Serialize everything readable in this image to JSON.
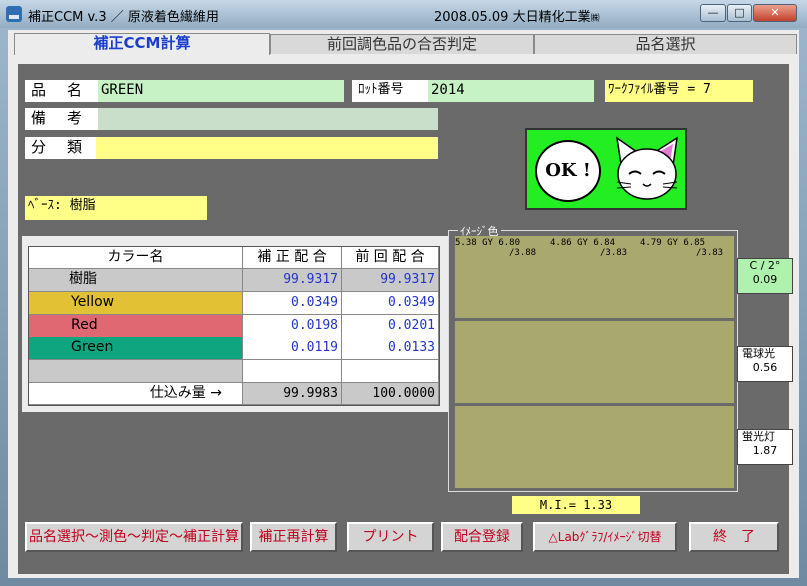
{
  "window": {
    "title": "補正CCM  v.3 ／ 原液着色繊維用",
    "title_right": "2008.05.09 大日精化工業",
    "company_mark": "㈱",
    "min": "—",
    "max": "□",
    "close": "✕"
  },
  "tabs": [
    "補正CCM計算",
    "前回調色品の合否判定",
    "品名選択"
  ],
  "form": {
    "hinmei_label": "品　名",
    "hinmei_value": "GREEN",
    "lot_label": "ﾛｯﾄ番号",
    "lot_value": "2014",
    "work_file": "ﾜｰｸﾌｧｲﾙ番号 = 7",
    "biko_label": "備　考",
    "biko_value": "",
    "bunrui_label": "分　類",
    "bunrui_value": "",
    "base": "ﾍﾞｰｽ: 樹脂"
  },
  "ok_badge": "OK !",
  "table": {
    "headers": [
      "カラー名",
      "補 正 配 合",
      "前 回 配 合"
    ],
    "rows": [
      {
        "name": "樹脂",
        "corr": "99.9317",
        "prev": "99.9317",
        "bg": "#c9c9c9",
        "fg": "#000"
      },
      {
        "name": "Yellow",
        "corr": "0.0349",
        "prev": "0.0349",
        "bg": "#e3c134",
        "fg": "#000"
      },
      {
        "name": "Red",
        "corr": "0.0198",
        "prev": "0.0201",
        "bg": "#e06873",
        "fg": "#000"
      },
      {
        "name": "Green",
        "corr": "0.0119",
        "prev": "0.0133",
        "bg": "#0fa57e",
        "fg": "#000"
      },
      {
        "name": "",
        "corr": "",
        "prev": "",
        "bg": "#c9c9c9",
        "fg": "#000"
      }
    ],
    "total_label": "仕込み量 →",
    "total_corr": "99.9983",
    "total_prev": "100.0000"
  },
  "image": {
    "label": "ｲﾒｰｼﾞ色",
    "readouts": [
      {
        "top": "5.38 GY 6.80",
        "bot": "/3.88"
      },
      {
        "top": "4.86 GY 6.84",
        "bot": "/3.83"
      },
      {
        "top": "4.79 GY 6.85",
        "bot": "/3.83"
      }
    ],
    "swatch_color": "#a9a86f"
  },
  "side": {
    "c2": "C / 2°",
    "c2_val": "0.09",
    "bulb": "電球光",
    "bulb_val": "0.56",
    "fluor": "蛍光灯",
    "fluor_val": "1.87"
  },
  "mi": "M.I.= 1.33",
  "buttons": [
    "品名選択～測色～判定～補正計算",
    "補正再計算",
    "プリント",
    "配合登録",
    "△Labｸﾞﾗﾌ/ｲﾒｰｼﾞ切替",
    "終　了"
  ]
}
